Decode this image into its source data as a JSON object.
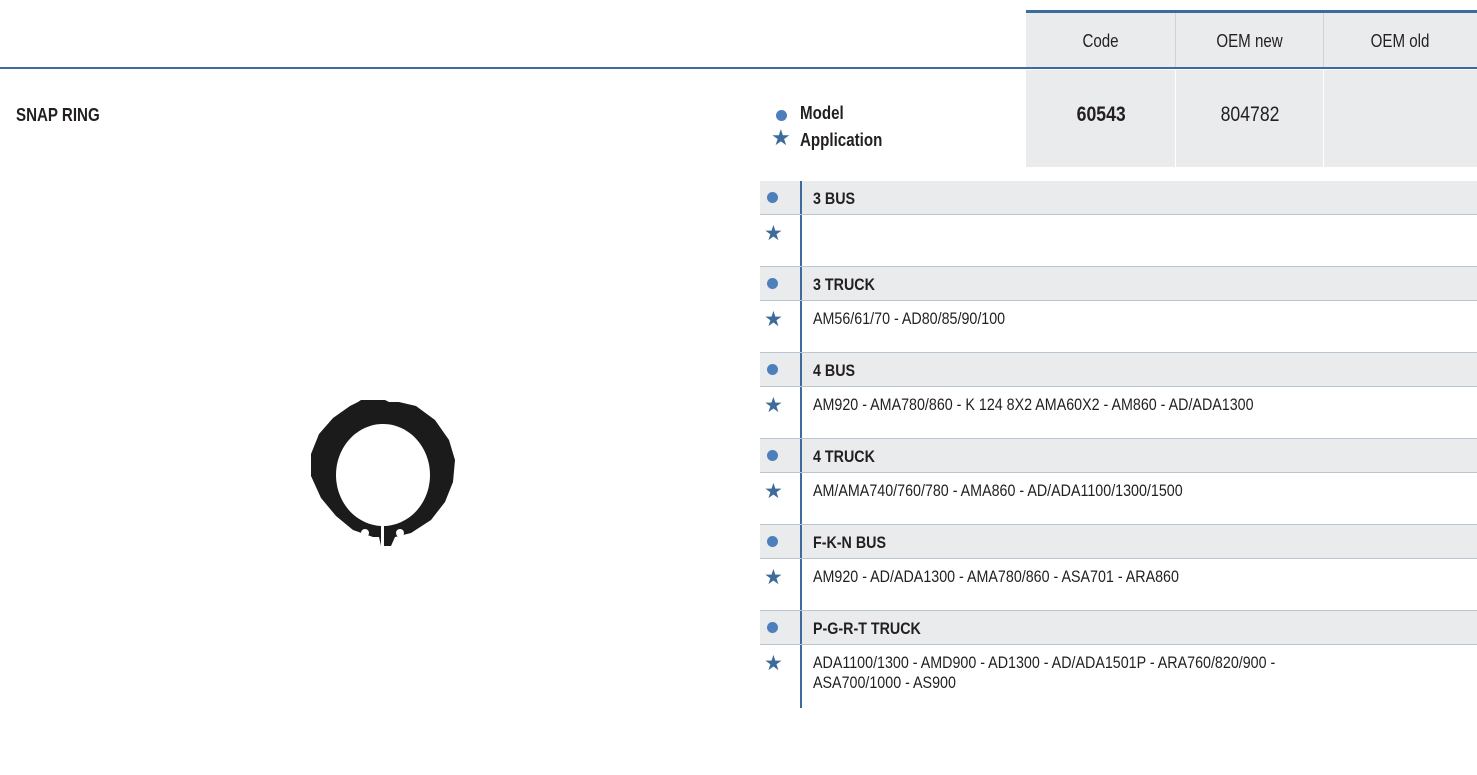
{
  "header": {
    "columns": [
      "Code",
      "OEM new",
      "OEM old"
    ]
  },
  "product": {
    "title": "SNAP RING",
    "legend": {
      "model": "Model",
      "application": "Application"
    },
    "code": "60543",
    "oem_new": "804782",
    "oem_old": ""
  },
  "applications": [
    {
      "model": "3 BUS",
      "application": ""
    },
    {
      "model": "3 TRUCK",
      "application": "AM56/61/70 - AD80/85/90/100"
    },
    {
      "model": "4 BUS",
      "application": "AM920 - AMA780/860 - K 124 8X2 AMA60X2 - AM860 - AD/ADA1300"
    },
    {
      "model": "4 TRUCK",
      "application": "AM/AMA740/760/780 - AMA860 - AD/ADA1100/1300/1500"
    },
    {
      "model": "F-K-N BUS",
      "application": "AM920 - AD/ADA1300 - AMA780/860 - ASA701 - ARA860"
    },
    {
      "model": "P-G-R-T TRUCK",
      "application_lines": [
        "ADA1100/1300 - AMD900 - AD1300 - AD/ADA1501P - ARA760/820/900 -",
        "ASA700/1000 - AS900"
      ]
    }
  ],
  "icons": {
    "model_marker": "dot-icon",
    "application_marker": "star-icon"
  },
  "colors": {
    "accent": "#3d6b9b",
    "dot": "#4d7fbd",
    "header_bg": "#e9ebec"
  }
}
